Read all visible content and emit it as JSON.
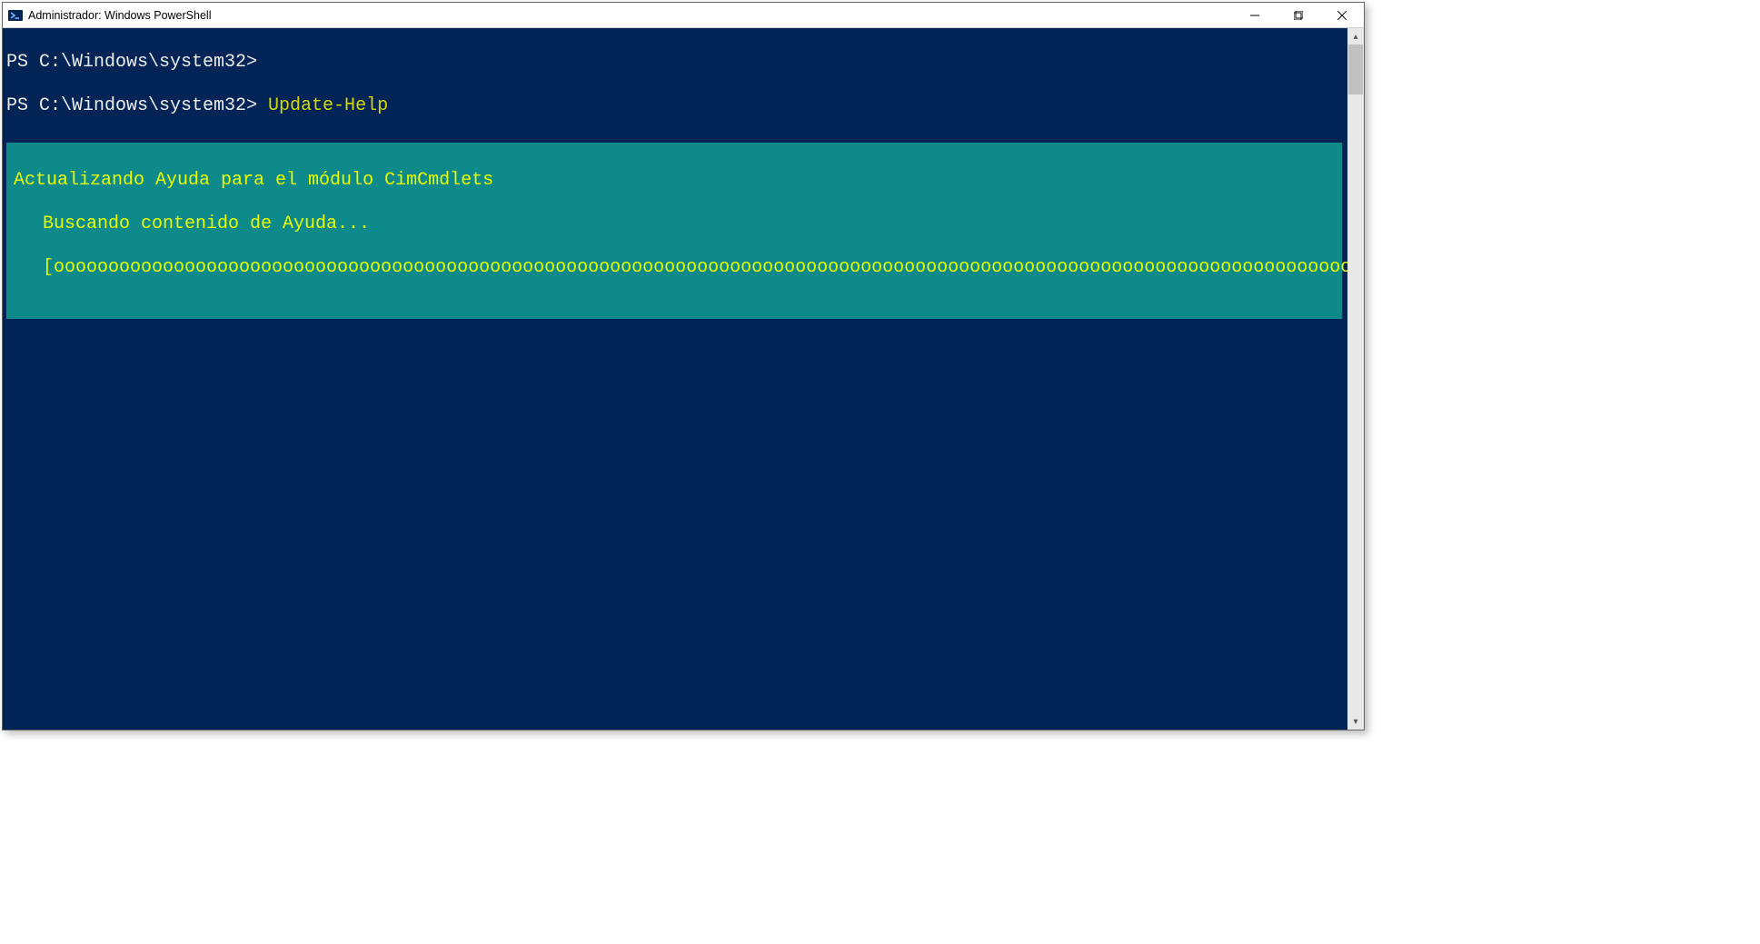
{
  "window": {
    "title": "Administrador: Windows PowerShell"
  },
  "console": {
    "prompt1": "PS C:\\Windows\\system32>",
    "prompt2": "PS C:\\Windows\\system32> ",
    "command": "Update-Help"
  },
  "progress": {
    "title": "Actualizando Ayuda para el módulo CimCmdlets",
    "subtitle": "Buscando contenido de Ayuda...",
    "bar": "[ooooooooooooooooooooooooooooooooooooooooooooooooooooooooooooooooooooooooooooooooooooooooooooooooooooooooooooooooooooooooooooooooooooo]"
  }
}
